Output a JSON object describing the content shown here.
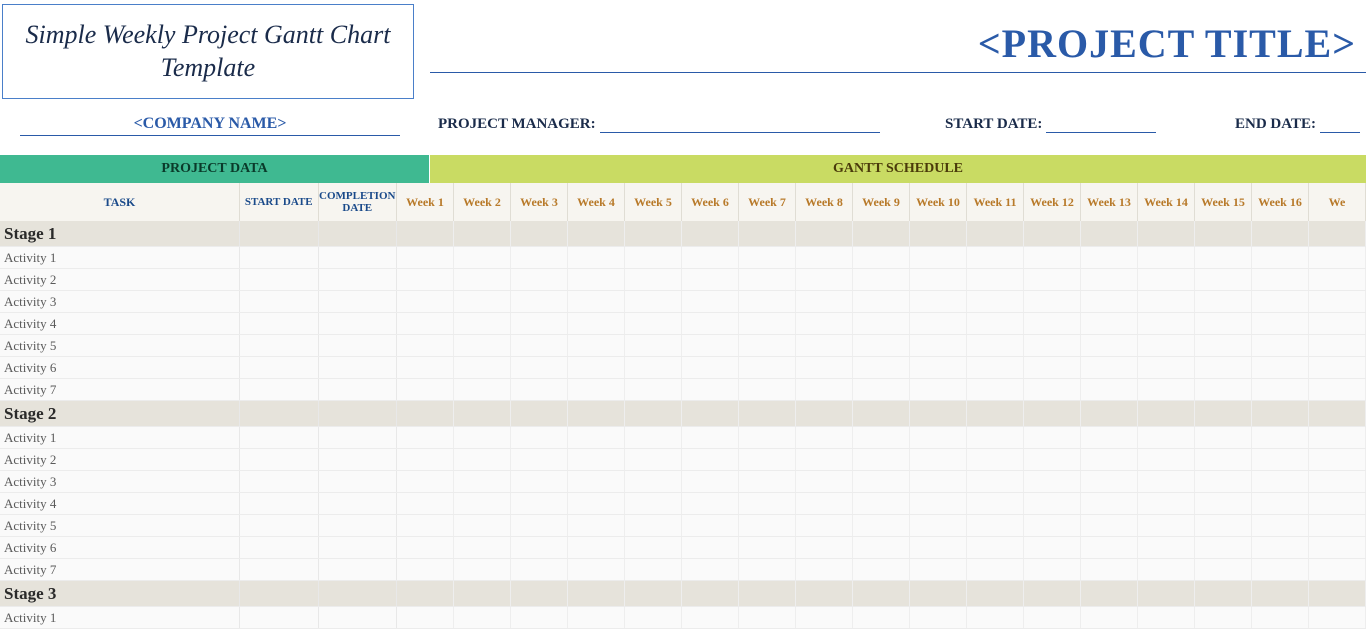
{
  "template_title": "Simple Weekly Project Gantt Chart Template",
  "project_title": "<PROJECT TITLE>",
  "company_name": "<COMPANY NAME>",
  "meta": {
    "project_manager_label": "PROJECT MANAGER:",
    "start_date_label": "START DATE:",
    "end_date_label": "END DATE:"
  },
  "section_headers": {
    "project_data": "PROJECT DATA",
    "gantt_schedule": "GANTT SCHEDULE"
  },
  "column_headers": {
    "task": "TASK",
    "start_date": "START DATE",
    "completion_date": "COMPLETION DATE"
  },
  "weeks": [
    "Week 1",
    "Week 2",
    "Week 3",
    "Week 4",
    "Week 5",
    "Week 6",
    "Week 7",
    "Week 8",
    "Week 9",
    "Week 10",
    "Week 11",
    "Week 12",
    "Week 13",
    "Week 14",
    "Week 15",
    "Week 16",
    "We"
  ],
  "rows": [
    {
      "label": "Stage 1",
      "type": "stage"
    },
    {
      "label": "Activity 1",
      "type": "activity"
    },
    {
      "label": "Activity 2",
      "type": "activity"
    },
    {
      "label": "Activity 3",
      "type": "activity"
    },
    {
      "label": "Activity 4",
      "type": "activity"
    },
    {
      "label": "Activity 5",
      "type": "activity"
    },
    {
      "label": "Activity 6",
      "type": "activity"
    },
    {
      "label": "Activity 7",
      "type": "activity"
    },
    {
      "label": "Stage 2",
      "type": "stage"
    },
    {
      "label": "Activity 1",
      "type": "activity"
    },
    {
      "label": "Activity 2",
      "type": "activity"
    },
    {
      "label": "Activity 3",
      "type": "activity"
    },
    {
      "label": "Activity 4",
      "type": "activity"
    },
    {
      "label": "Activity 5",
      "type": "activity"
    },
    {
      "label": "Activity 6",
      "type": "activity"
    },
    {
      "label": "Activity 7",
      "type": "activity"
    },
    {
      "label": "Stage 3",
      "type": "stage"
    },
    {
      "label": "Activity 1",
      "type": "activity"
    }
  ],
  "chart_data": {
    "type": "table",
    "title": "Simple Weekly Project Gantt Chart Template",
    "columns": [
      "TASK",
      "START DATE",
      "COMPLETION DATE",
      "Week 1",
      "Week 2",
      "Week 3",
      "Week 4",
      "Week 5",
      "Week 6",
      "Week 7",
      "Week 8",
      "Week 9",
      "Week 10",
      "Week 11",
      "Week 12",
      "Week 13",
      "Week 14",
      "Week 15",
      "Week 16"
    ],
    "stages": [
      {
        "name": "Stage 1",
        "activities": [
          "Activity 1",
          "Activity 2",
          "Activity 3",
          "Activity 4",
          "Activity 5",
          "Activity 6",
          "Activity 7"
        ]
      },
      {
        "name": "Stage 2",
        "activities": [
          "Activity 1",
          "Activity 2",
          "Activity 3",
          "Activity 4",
          "Activity 5",
          "Activity 6",
          "Activity 7"
        ]
      },
      {
        "name": "Stage 3",
        "activities": [
          "Activity 1"
        ]
      }
    ]
  }
}
